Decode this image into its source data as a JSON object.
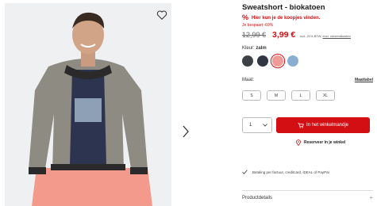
{
  "product": {
    "title": "Sweatshort - biokatoen",
    "promo_symbol": "%",
    "promo_text": "Hier kun je de koopjes vinden.",
    "saved_text": "Je bespaart -69%",
    "old_price": "12,99 €",
    "new_price": "3,99 €",
    "vat_text": "incl. 21% BTW,",
    "shipping_link": "excl. verzendkosten"
  },
  "colors": {
    "label": "Kleur:",
    "selected_name": "zalm",
    "swatches": [
      {
        "name": "dark-grey",
        "hex": "#3d4146"
      },
      {
        "name": "navy",
        "hex": "#2f3542"
      },
      {
        "name": "salmon",
        "hex": "#f09b98",
        "selected": true
      },
      {
        "name": "light-blue",
        "hex": "#88aed2"
      }
    ]
  },
  "sizes": {
    "label": "Maat:",
    "table_link": "Maattabel",
    "options": [
      "S",
      "M",
      "L",
      "XL"
    ]
  },
  "cart": {
    "quantity": "1",
    "add_button": "In het winkelmandje",
    "reserve_link": "Reserveer in je winkel"
  },
  "payment_text": "Betaling per factuur, creditcard, iDEAL of PayPal",
  "details_label": "Productdetails",
  "accent": "#d40f14"
}
